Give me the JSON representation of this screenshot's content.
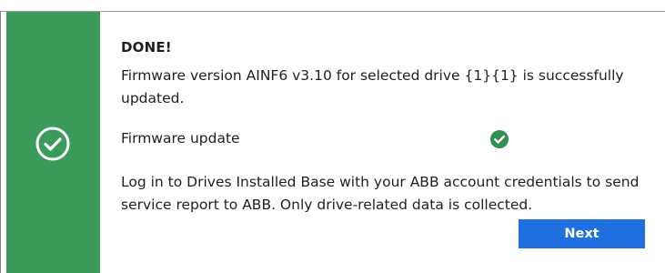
{
  "dialog": {
    "title": "DONE!",
    "message": "Firmware version AINF6 v3.10 for selected drive  {1}{1} is successfully updated.",
    "status_icon": "check-circle-icon",
    "accent_color": "#3a9b5a",
    "steps": [
      {
        "label": "Firmware update",
        "status_icon": "check-circle-filled-icon"
      }
    ],
    "info": "Log in to Drives Installed Base with your ABB account credentials to send service report to ABB. Only drive-related data is collected.",
    "next_label": "Next",
    "button_color": "#1f6fe0"
  }
}
